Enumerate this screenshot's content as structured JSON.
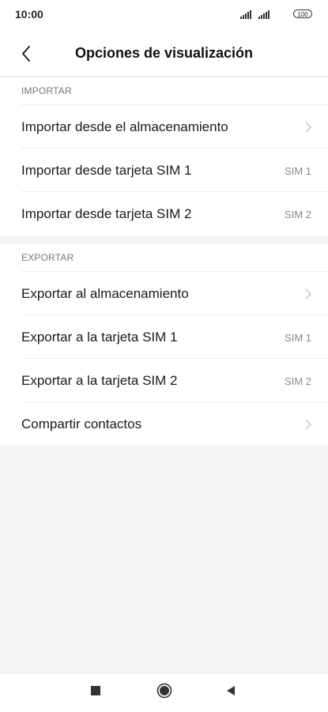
{
  "status_bar": {
    "time": "10:00",
    "battery": "100",
    "icons": [
      "signal-icon",
      "signal-icon",
      "battery-icon"
    ]
  },
  "header": {
    "title": "Opciones de visualización",
    "back_icon": "chevron-left-icon"
  },
  "sections": [
    {
      "label": "IMPORTAR",
      "items": [
        {
          "label": "Importar desde el almacenamiento",
          "value": "",
          "icon": "chevron-right-icon"
        },
        {
          "label": "Importar desde tarjeta SIM 1",
          "value": "SIM 1"
        },
        {
          "label": "Importar desde tarjeta SIM 2",
          "value": "SIM 2"
        }
      ]
    },
    {
      "label": "EXPORTAR",
      "items": [
        {
          "label": "Exportar al almacenamiento",
          "value": "",
          "icon": "chevron-right-icon"
        },
        {
          "label": "Exportar a la tarjeta SIM 1",
          "value": "SIM 1"
        },
        {
          "label": "Exportar a la tarjeta SIM 2",
          "value": "SIM 2"
        },
        {
          "label": "Compartir contactos",
          "value": "",
          "icon": "chevron-right-icon"
        }
      ]
    }
  ],
  "nav_bar": {
    "icons": [
      "recent-apps-icon",
      "home-icon",
      "back-icon"
    ]
  },
  "colors": {
    "background": "#f4f4f4",
    "surface": "#ffffff",
    "text": "#1a1a1a",
    "secondary_text": "#8a8a8a"
  }
}
